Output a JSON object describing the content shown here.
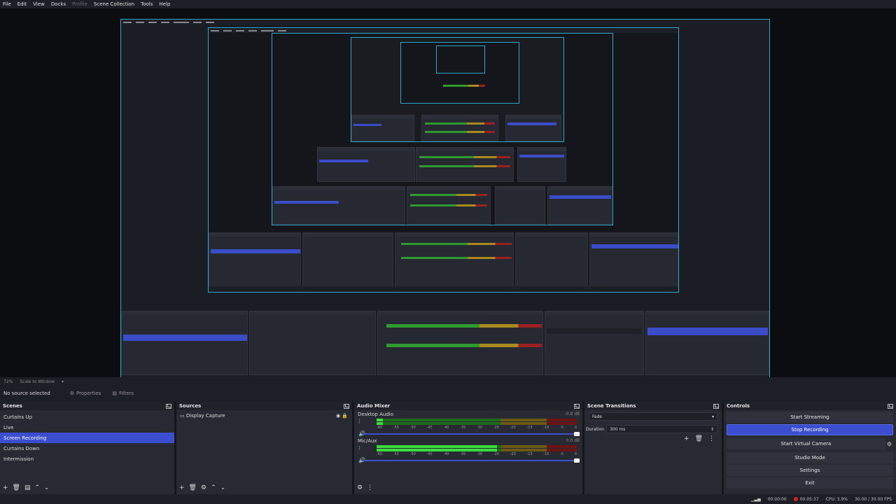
{
  "menu": [
    "File",
    "Edit",
    "View",
    "Docks",
    "Profile",
    "Scene Collection",
    "Tools",
    "Help"
  ],
  "preview_toolbar": {
    "zoom": "72%",
    "scale_mode": "Scale to Window"
  },
  "source_bar": {
    "no_source": "No source selected",
    "properties": "Properties",
    "filters": "Filters"
  },
  "scenes": {
    "title": "Scenes",
    "items": [
      "Curtains Up",
      "Live",
      "Screen Recording",
      "Curtains Down",
      "Intermission"
    ],
    "selected": 2
  },
  "sources": {
    "title": "Sources",
    "items": [
      {
        "label": "Display Capture"
      }
    ]
  },
  "audio": {
    "title": "Audio Mixer",
    "ticks": [
      "-60",
      "-55",
      "-50",
      "-45",
      "-40",
      "-35",
      "-30",
      "-25",
      "-20",
      "-15",
      "-10",
      "-5",
      "0"
    ],
    "channels": [
      {
        "name": "Desktop Audio",
        "db": "-0.8 dB",
        "level": 0.03
      },
      {
        "name": "Mic/Aux",
        "db": "0.0 dB",
        "level": 0.6
      }
    ]
  },
  "transitions": {
    "title": "Scene Transitions",
    "type": "Fade",
    "duration_label": "Duration",
    "duration": "300 ms"
  },
  "controls": {
    "title": "Controls",
    "buttons": [
      "Start Streaming",
      "Stop Recording",
      "Start Virtual Camera",
      "Studio Mode",
      "Settings",
      "Exit"
    ],
    "active": 1
  },
  "status": {
    "stream_time": "00:00:00",
    "rec_time": "00:05:37",
    "cpu": "CPU: 3.9%",
    "fps": "30.00 / 30.00 FPS"
  },
  "colors": {
    "accent": "#3c4ed0",
    "preview_border": "#2ea8c8",
    "record": "#e02020"
  }
}
